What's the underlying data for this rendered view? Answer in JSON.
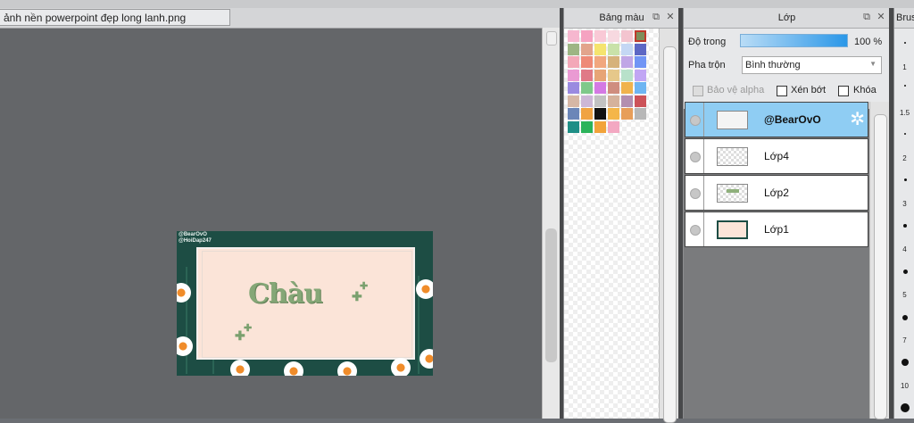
{
  "document": {
    "tab_title": "ảnh nền powerpoint đẹp long lanh.png"
  },
  "artwork": {
    "watermark_line1": "@BearOvO",
    "watermark_line2": "@HoiDap247",
    "title": "Chàu"
  },
  "palette": {
    "title": "Bảng màu",
    "swatches": [
      "#f6b7cf",
      "#f5a3c1",
      "#f9c9d6",
      "#f7d9e0",
      "#f3c4cf",
      "#7e8e5a",
      "#9db584",
      "#e2a48c",
      "#f5e46e",
      "#c9e2a9",
      "#c4d7f4",
      "#5d67c4",
      "#f3a8b8",
      "#ee8a77",
      "#f1a77e",
      "#d6b27b",
      "#c0a6e6",
      "#7195f5",
      "#ea9ad3",
      "#e07a87",
      "#e7a576",
      "#e6c88a",
      "#b8e1ca",
      "#c1a6f4",
      "#9a8ae0",
      "#7fc98a",
      "#d47ae4",
      "#cf8d7f",
      "#f0b34d",
      "#6eb5f2",
      "#d6b7a5",
      "#cdb7d6",
      "#c2c2c2",
      "#d5b29c",
      "#b38fb0",
      "#cc5258",
      "#6b86b8",
      "#f0a343",
      "#121212",
      "#f4b64a",
      "#e79e5a",
      "#b7b7b7",
      "#1f8f86",
      "#2bb35a",
      "#f2a33a",
      "#f3a8c2"
    ]
  },
  "layers": {
    "title": "Lớp",
    "opacity_label": "Độ trong",
    "opacity_value": "100 %",
    "blend_label": "Pha trộn",
    "blend_value": "Bình thường",
    "protect_alpha": "Bảo vệ alpha",
    "clipping": "Xén bớt",
    "lock": "Khóa",
    "items": [
      {
        "name": "@BearOvO",
        "selected": true
      },
      {
        "name": "Lớp4",
        "selected": false
      },
      {
        "name": "Lớp2",
        "selected": false
      },
      {
        "name": "Lớp1",
        "selected": false
      }
    ]
  },
  "brush": {
    "title": "Brus",
    "sizes": [
      "1",
      "1.5",
      "2",
      "3",
      "4",
      "5",
      "7",
      "10"
    ]
  }
}
